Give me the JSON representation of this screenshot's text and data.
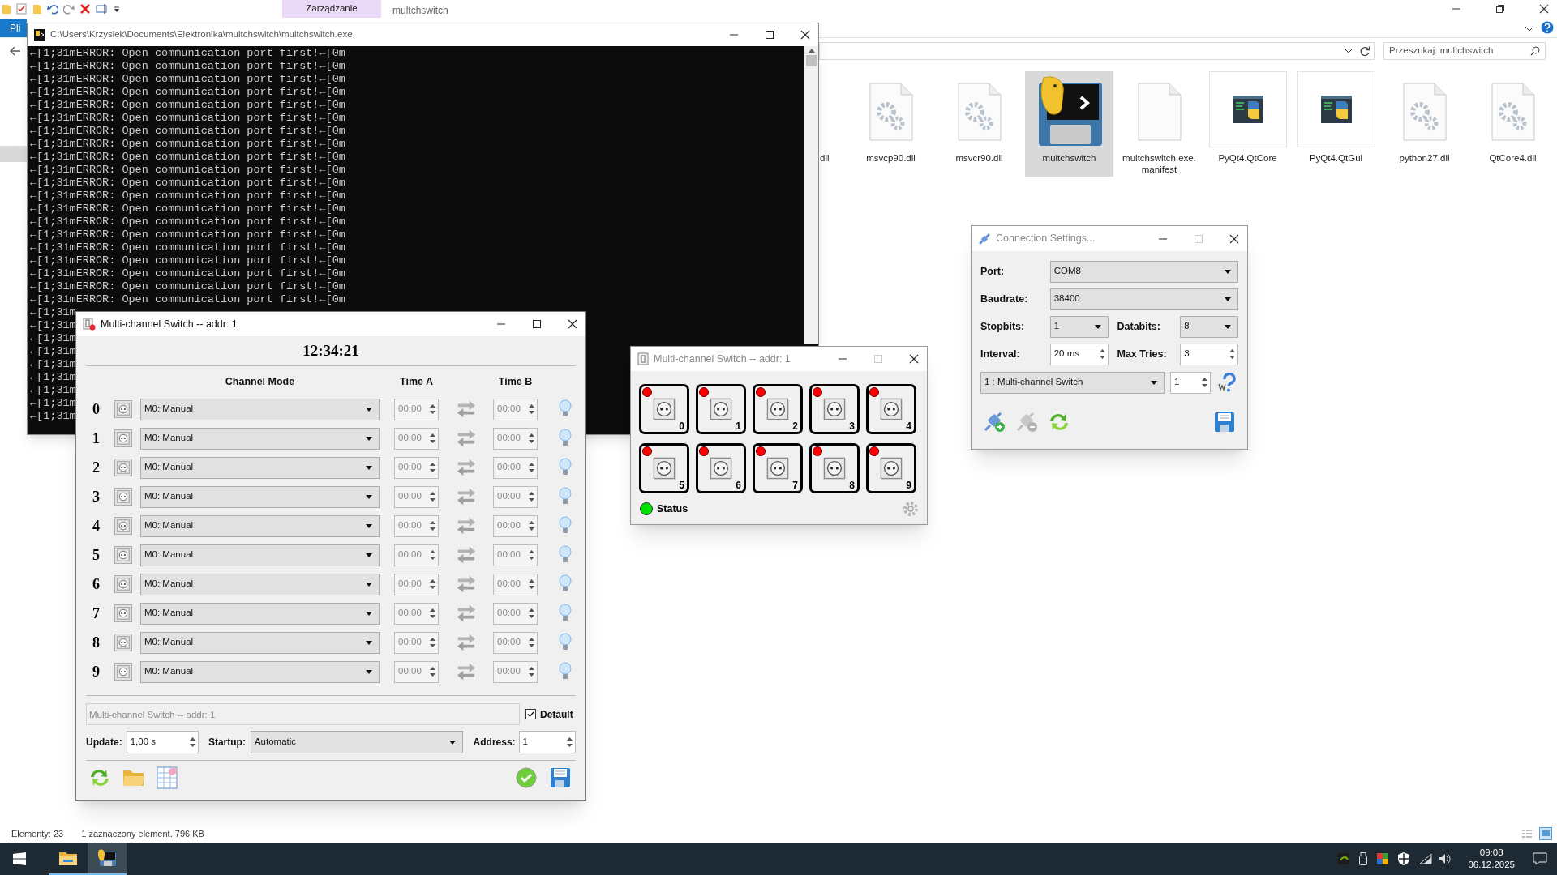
{
  "explorer": {
    "ribbon_tab": "Zarządzanie",
    "title": "multchswitch",
    "file_tab": "Pli",
    "search": {
      "placeholder": "Przeszukaj: multchswitch"
    },
    "files": [
      {
        "name": "dll",
        "kind": "partial",
        "selected": false
      },
      {
        "name": "msvcp90.dll",
        "kind": "dll",
        "selected": false
      },
      {
        "name": "msvcr90.dll",
        "kind": "dll",
        "selected": false
      },
      {
        "name": "multchswitch",
        "kind": "exe",
        "selected": true
      },
      {
        "name": "multchswitch.exe.manifest",
        "kind": "manifest",
        "selected": false
      },
      {
        "name": "PyQt4.QtCore",
        "kind": "pyd",
        "selected": false
      },
      {
        "name": "PyQt4.QtGui",
        "kind": "pyd",
        "selected": false
      },
      {
        "name": "python27.dll",
        "kind": "dll",
        "selected": false
      },
      {
        "name": "QtCore4.dll",
        "kind": "dll",
        "selected": false
      }
    ],
    "status_bar": {
      "count": "Elementy: 23",
      "selection": "1 zaznaczony element. 796 KB"
    }
  },
  "console": {
    "title": "C:\\Users\\Krzysiek\\Documents\\Elektronika\\multchswitch\\multchswitch.exe",
    "lines": [
      "←[1;31mERROR: Open communication port first!←[0m",
      "←[1;31mERROR: Open communication port first!←[0m",
      "←[1;31mERROR: Open communication port first!←[0m",
      "←[1;31mERROR: Open communication port first!←[0m",
      "←[1;31mERROR: Open communication port first!←[0m",
      "←[1;31mERROR: Open communication port first!←[0m",
      "←[1;31mERROR: Open communication port first!←[0m",
      "←[1;31mERROR: Open communication port first!←[0m",
      "←[1;31mERROR: Open communication port first!←[0m",
      "←[1;31mERROR: Open communication port first!←[0m",
      "←[1;31mERROR: Open communication port first!←[0m",
      "←[1;31mERROR: Open communication port first!←[0m",
      "←[1;31mERROR: Open communication port first!←[0m",
      "←[1;31mERROR: Open communication port first!←[0m",
      "←[1;31mERROR: Open communication port first!←[0m",
      "←[1;31mERROR: Open communication port first!←[0m",
      "←[1;31mERROR: Open communication port first!←[0m",
      "←[1;31mERROR: Open communication port first!←[0m",
      "←[1;31mERROR: Open communication port first!←[0m",
      "←[1;31mERROR: Open communication port first!←[0m",
      "←[1;31m",
      "←[1;31m",
      "←[1;31m",
      "←[1;31m",
      "←[1;31m",
      "←[1;31m",
      "←[1;31m",
      "←[1;31m",
      "←[1;31m"
    ]
  },
  "switch_window": {
    "title": "Multi-channel Switch -- addr: 1",
    "clock": "12:34:21",
    "columns": [
      "Channel Mode",
      "Time A",
      "Time B"
    ],
    "channels": [
      {
        "number": "0",
        "mode": "M0: Manual",
        "time_a": "00:00",
        "time_b": "00:00",
        "disabled": true
      },
      {
        "number": "1",
        "mode": "M0: Manual",
        "time_a": "00:00",
        "time_b": "00:00",
        "disabled": true
      },
      {
        "number": "2",
        "mode": "M0: Manual",
        "time_a": "00:00",
        "time_b": "00:00",
        "disabled": true
      },
      {
        "number": "3",
        "mode": "M0: Manual",
        "time_a": "00:00",
        "time_b": "00:00",
        "disabled": true
      },
      {
        "number": "4",
        "mode": "M0: Manual",
        "time_a": "00:00",
        "time_b": "00:00",
        "disabled": true
      },
      {
        "number": "5",
        "mode": "M0: Manual",
        "time_a": "00:00",
        "time_b": "00:00",
        "disabled": true
      },
      {
        "number": "6",
        "mode": "M0: Manual",
        "time_a": "00:00",
        "time_b": "00:00",
        "disabled": true
      },
      {
        "number": "7",
        "mode": "M0: Manual",
        "time_a": "00:00",
        "time_b": "00:00",
        "disabled": true
      },
      {
        "number": "8",
        "mode": "M0: Manual",
        "time_a": "00:00",
        "time_b": "00:00",
        "disabled": true
      },
      {
        "number": "9",
        "mode": "M0: Manual",
        "time_a": "00:00",
        "time_b": "00:00",
        "disabled": true
      }
    ],
    "name_field": {
      "placeholder": "Multi-channel Switch -- addr: 1"
    },
    "default": {
      "label": "Default",
      "checked": true
    },
    "update": {
      "label": "Update:",
      "value": "1,00 s"
    },
    "startup": {
      "label": "Startup:",
      "value": "Automatic"
    },
    "address": {
      "label": "Address:",
      "value": "1"
    }
  },
  "panel_window": {
    "title": "Multi-channel Switch -- addr: 1",
    "outlets": [
      {
        "number": "0",
        "on": false
      },
      {
        "number": "1",
        "on": false
      },
      {
        "number": "2",
        "on": false
      },
      {
        "number": "3",
        "on": false
      },
      {
        "number": "4",
        "on": false
      },
      {
        "number": "5",
        "on": false
      },
      {
        "number": "6",
        "on": false
      },
      {
        "number": "7",
        "on": false
      },
      {
        "number": "8",
        "on": false
      },
      {
        "number": "9",
        "on": false
      }
    ],
    "status": {
      "label": "Status",
      "connected": true
    }
  },
  "connection": {
    "title": "Connection Settings...",
    "port": {
      "label": "Port:",
      "value": "COM8"
    },
    "baudrate": {
      "label": "Baudrate:",
      "value": "38400"
    },
    "stopbits": {
      "label": "Stopbits:",
      "value": "1"
    },
    "databits": {
      "label": "Databits:",
      "value": "8"
    },
    "interval": {
      "label": "Interval:",
      "value": "20 ms"
    },
    "max_tries": {
      "label": "Max Tries:",
      "value": "3"
    },
    "device": {
      "value": "1 : Multi-channel Switch"
    },
    "device_count": {
      "value": "1"
    }
  },
  "taskbar": {
    "apps": [
      {
        "kind": "explorer",
        "selected": false
      },
      {
        "kind": "python",
        "selected": true
      }
    ],
    "time": "09:08",
    "date": "06.12.2025"
  }
}
